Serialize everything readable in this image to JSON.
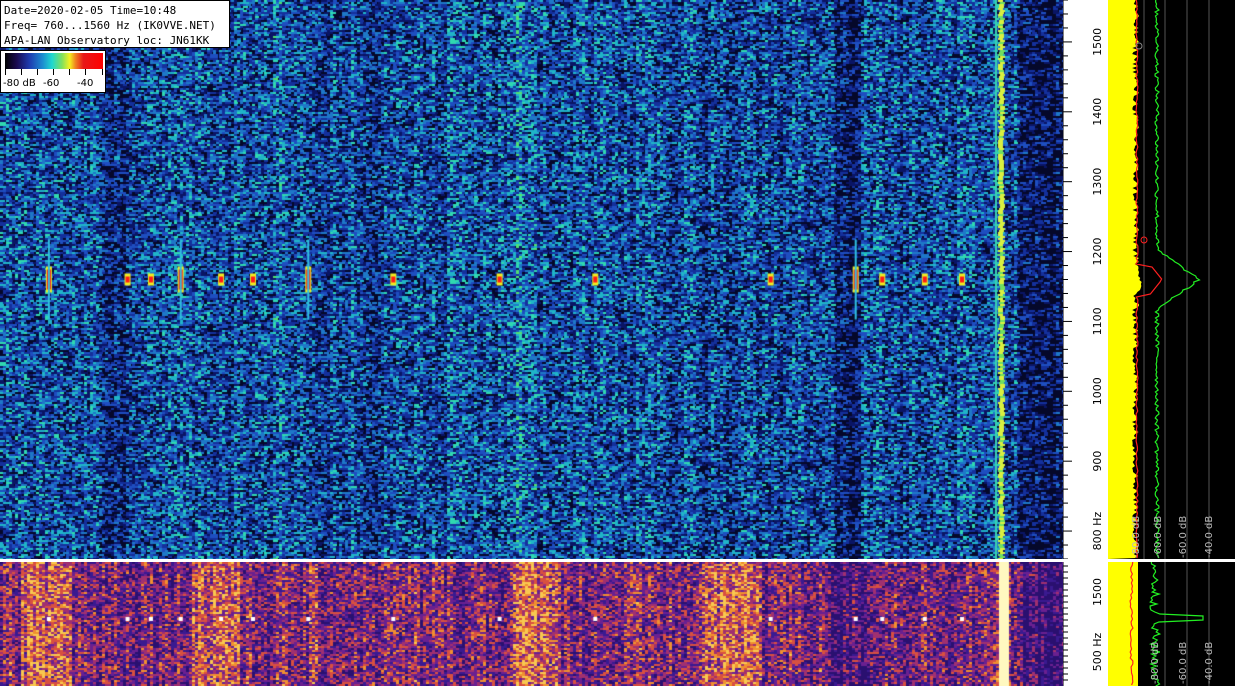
{
  "header": {
    "line1": "Date=2020-02-05 Time=10:48",
    "line2": "Freq= 760...1560 Hz (IK0VVE.NET)",
    "line3": "APA-LAN Observatory loc: JN61KK"
  },
  "colorscale": {
    "labels": [
      "-80 dB",
      "-60",
      "-40"
    ]
  },
  "chart_data": [
    {
      "type": "heatmap",
      "title": "",
      "y_unit": "Hz",
      "ylim": [
        760,
        1560
      ],
      "y_ticks": [
        800,
        900,
        1000,
        1100,
        1200,
        1300,
        1400,
        1500
      ],
      "y_tick_labels": [
        "800 Hz",
        "900",
        "1000",
        "1100",
        "1200",
        "1300",
        "1400",
        "1500"
      ],
      "carrier_freq_hz": 1160,
      "echo_positions_fraction": [
        0.046,
        0.12,
        0.142,
        0.17,
        0.208,
        0.238,
        0.29,
        0.37,
        0.47,
        0.56,
        0.725,
        0.805,
        0.83,
        0.87,
        0.905
      ],
      "strong_echo_positions_fraction": [
        0.046,
        0.17,
        0.29,
        0.805
      ],
      "spectrum_db_labels": [
        "-80.0 dB",
        "-60.0 dB",
        "-60.0 dB",
        "-40.0 dB"
      ],
      "colors": {
        "yellow": "#ffff00",
        "green": "#22ee22",
        "red": "#ff2020"
      }
    },
    {
      "type": "heatmap",
      "title": "",
      "y_unit": "Hz",
      "y_ticks": [
        500,
        1500
      ],
      "y_tick_labels": [
        "500 Hz",
        "1500"
      ],
      "spectrum_db_labels": [
        "-80.0 dB",
        "-60.0 dB",
        "-40.0 dB"
      ]
    }
  ]
}
